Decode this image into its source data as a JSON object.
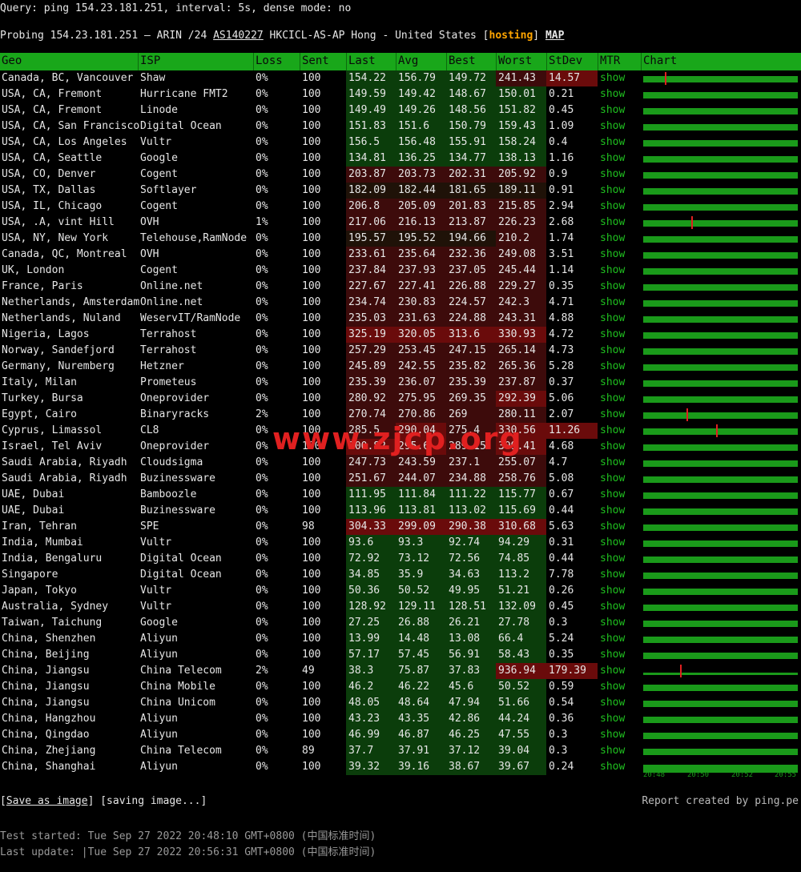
{
  "header": {
    "query": "Query: ping 154.23.181.251, interval: 5s, dense mode: no",
    "probe_prefix": "Probing 154.23.181.251 — ARIN /24 ",
    "asn": "AS140227",
    "probe_mid": " HKCICL-AS-AP Hong - United States [",
    "hosting": "hosting",
    "probe_close": "] ",
    "map": "MAP"
  },
  "columns": [
    "Geo",
    "ISP",
    "Loss",
    "Sent",
    "Last",
    "Avg",
    "Best",
    "Worst",
    "StDev",
    "MTR",
    "Chart"
  ],
  "mtr_label": "show",
  "rows": [
    [
      "Canada, BC, Vancouver",
      "Shaw",
      "0%",
      "100",
      "154.22",
      "156.79",
      "149.72",
      "241.43",
      "14.57"
    ],
    [
      "USA, CA, Fremont",
      "Hurricane FMT2",
      "0%",
      "100",
      "149.59",
      "149.42",
      "148.67",
      "150.01",
      "0.21"
    ],
    [
      "USA, CA, Fremont",
      "Linode",
      "0%",
      "100",
      "149.49",
      "149.26",
      "148.56",
      "151.82",
      "0.45"
    ],
    [
      "USA, CA, San Francisco",
      "Digital Ocean",
      "0%",
      "100",
      "151.83",
      "151.6",
      "150.79",
      "159.43",
      "1.09"
    ],
    [
      "USA, CA, Los Angeles",
      "Vultr",
      "0%",
      "100",
      "156.5",
      "156.48",
      "155.91",
      "158.24",
      "0.4"
    ],
    [
      "USA, CA, Seattle",
      "Google",
      "0%",
      "100",
      "134.81",
      "136.25",
      "134.77",
      "138.13",
      "1.16"
    ],
    [
      "USA, CO, Denver",
      "Cogent",
      "0%",
      "100",
      "203.87",
      "203.73",
      "202.31",
      "205.92",
      "0.9"
    ],
    [
      "USA, TX, Dallas",
      "Softlayer",
      "0%",
      "100",
      "182.09",
      "182.44",
      "181.65",
      "189.11",
      "0.91"
    ],
    [
      "USA, IL, Chicago",
      "Cogent",
      "0%",
      "100",
      "206.8",
      "205.09",
      "201.83",
      "215.85",
      "2.94"
    ],
    [
      "USA, .A, vint Hill",
      "OVH",
      "1%",
      "100",
      "217.06",
      "216.13",
      "213.87",
      "226.23",
      "2.68"
    ],
    [
      "USA, NY, New York",
      "Telehouse,RamNode",
      "0%",
      "100",
      "195.57",
      "195.52",
      "194.66",
      "210.2",
      "1.74"
    ],
    [
      "Canada, QC, Montreal",
      "OVH",
      "0%",
      "100",
      "233.61",
      "235.64",
      "232.36",
      "249.08",
      "3.51"
    ],
    [
      "UK, London",
      "Cogent",
      "0%",
      "100",
      "237.84",
      "237.93",
      "237.05",
      "245.44",
      "1.14"
    ],
    [
      "France, Paris",
      "Online.net",
      "0%",
      "100",
      "227.67",
      "227.41",
      "226.88",
      "229.27",
      "0.35"
    ],
    [
      "Netherlands, Amsterdam",
      "Online.net",
      "0%",
      "100",
      "234.74",
      "230.83",
      "224.57",
      "242.3",
      "4.71"
    ],
    [
      "Netherlands, Nuland",
      "WeservIT/RamNode",
      "0%",
      "100",
      "235.03",
      "231.63",
      "224.88",
      "243.31",
      "4.88"
    ],
    [
      "Nigeria, Lagos",
      "Terrahost",
      "0%",
      "100",
      "325.19",
      "320.05",
      "313.6",
      "330.93",
      "4.72"
    ],
    [
      "Norway, Sandefjord",
      "Terrahost",
      "0%",
      "100",
      "257.29",
      "253.45",
      "247.15",
      "265.14",
      "4.73"
    ],
    [
      "Germany, Nuremberg",
      "Hetzner",
      "0%",
      "100",
      "245.89",
      "242.55",
      "235.82",
      "265.36",
      "5.28"
    ],
    [
      "Italy, Milan",
      "Prometeus",
      "0%",
      "100",
      "235.39",
      "236.07",
      "235.39",
      "237.87",
      "0.37"
    ],
    [
      "Turkey, Bursa",
      "Oneprovider",
      "0%",
      "100",
      "280.92",
      "275.95",
      "269.35",
      "292.39",
      "5.06"
    ],
    [
      "Egypt, Cairo",
      "Binaryracks",
      "2%",
      "100",
      "270.74",
      "270.86",
      "269",
      "280.11",
      "2.07"
    ],
    [
      "Cyprus, Limassol",
      "CL8",
      "0%",
      "100",
      "285.5",
      "290.04",
      "275.4",
      "330.56",
      "11.26"
    ],
    [
      "Israel, Tel Aviv",
      "Oneprovider",
      "0%",
      "100",
      "300.82",
      "295.6",
      "289.15",
      "309.41",
      "4.68"
    ],
    [
      "Saudi Arabia, Riyadh",
      "Cloudsigma",
      "0%",
      "100",
      "247.73",
      "243.59",
      "237.1",
      "255.07",
      "4.7"
    ],
    [
      "Saudi Arabia, Riyadh",
      "Buzinessware",
      "0%",
      "100",
      "251.67",
      "244.07",
      "234.88",
      "258.76",
      "5.08"
    ],
    [
      "UAE, Dubai",
      "Bamboozle",
      "0%",
      "100",
      "111.95",
      "111.84",
      "111.22",
      "115.77",
      "0.67"
    ],
    [
      "UAE, Dubai",
      "Buzinessware",
      "0%",
      "100",
      "113.96",
      "113.81",
      "113.02",
      "115.69",
      "0.44"
    ],
    [
      "Iran, Tehran",
      "SPE",
      "0%",
      "98",
      "304.33",
      "299.09",
      "290.38",
      "310.68",
      "5.63"
    ],
    [
      "India, Mumbai",
      "Vultr",
      "0%",
      "100",
      "93.6",
      "93.3",
      "92.74",
      "94.29",
      "0.31"
    ],
    [
      "India, Bengaluru",
      "Digital Ocean",
      "0%",
      "100",
      "72.92",
      "73.12",
      "72.56",
      "74.85",
      "0.44"
    ],
    [
      "Singapore",
      "Digital Ocean",
      "0%",
      "100",
      "34.85",
      "35.9",
      "34.63",
      "113.2",
      "7.78"
    ],
    [
      "Japan, Tokyo",
      "Vultr",
      "0%",
      "100",
      "50.36",
      "50.52",
      "49.95",
      "51.21",
      "0.26"
    ],
    [
      "Australia, Sydney",
      "Vultr",
      "0%",
      "100",
      "128.92",
      "129.11",
      "128.51",
      "132.09",
      "0.45"
    ],
    [
      "Taiwan, Taichung",
      "Google",
      "0%",
      "100",
      "27.25",
      "26.88",
      "26.21",
      "27.78",
      "0.3"
    ],
    [
      "China, Shenzhen",
      "Aliyun",
      "0%",
      "100",
      "13.99",
      "14.48",
      "13.08",
      "66.4",
      "5.24"
    ],
    [
      "China, Beijing",
      "Aliyun",
      "0%",
      "100",
      "57.17",
      "57.45",
      "56.91",
      "58.43",
      "0.35"
    ],
    [
      "China, Jiangsu",
      "China Telecom",
      "2%",
      "49",
      "38.3",
      "75.87",
      "37.83",
      "936.94",
      "179.39"
    ],
    [
      "China, Jiangsu",
      "China Mobile",
      "0%",
      "100",
      "46.2",
      "46.22",
      "45.6",
      "50.52",
      "0.59"
    ],
    [
      "China, Jiangsu",
      "China Unicom",
      "0%",
      "100",
      "48.05",
      "48.64",
      "47.94",
      "51.66",
      "0.54"
    ],
    [
      "China, Hangzhou",
      "Aliyun",
      "0%",
      "100",
      "43.23",
      "43.35",
      "42.86",
      "44.24",
      "0.36"
    ],
    [
      "China, Qingdao",
      "Aliyun",
      "0%",
      "100",
      "46.99",
      "46.87",
      "46.25",
      "47.55",
      "0.3"
    ],
    [
      "China, Zhejiang",
      "China Telecom",
      "0%",
      "89",
      "37.7",
      "37.91",
      "37.12",
      "39.04",
      "0.3"
    ],
    [
      "China, Shanghai",
      "Aliyun",
      "0%",
      "100",
      "39.32",
      "39.16",
      "38.67",
      "39.67",
      "0.24"
    ]
  ],
  "chart_axis": [
    "20:48",
    "20:50",
    "20:52",
    "20:55"
  ],
  "colors": {
    "header": "#19a71a",
    "mtr": "#1fc01f",
    "good": "#0b3d0b",
    "warn": "#3d0b0b",
    "bad": "#6a0b0b"
  },
  "footer": {
    "save_image": "Save as image",
    "saving": " [saving image...]",
    "report": "Report created by ping.pe",
    "started": "Test started: Tue Sep 27 2022 20:48:10 GMT+0800 (中国标准时间)",
    "updated": "Last update: |Tue Sep 27 2022 20:56:31 GMT+0800 (中国标准时间)"
  },
  "watermark": "www.zjcp.org"
}
